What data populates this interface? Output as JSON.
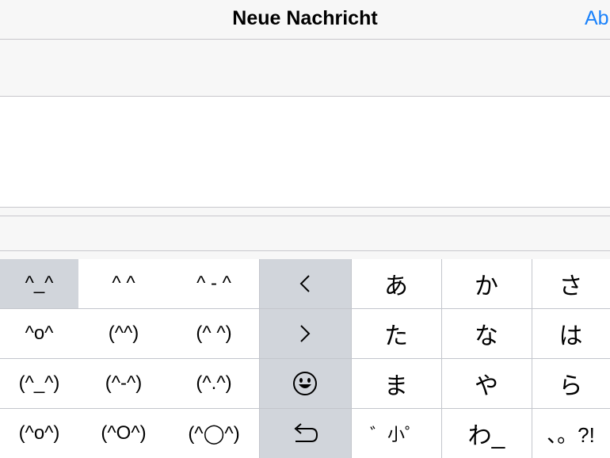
{
  "navbar": {
    "title": "Neue Nachricht",
    "cancel_label": "Ab"
  },
  "keyboard": {
    "faces": [
      [
        "^_^",
        "^ ^",
        "^ - ^"
      ],
      [
        "^o^",
        "(^^)",
        "(^ ^)"
      ],
      [
        "(^_^)",
        "(^-^)",
        "(^.^)"
      ],
      [
        "(^o^)",
        "(^O^)",
        "(^◯^)"
      ]
    ],
    "controls": [
      "‹",
      "›",
      "☺",
      "⮌"
    ],
    "control_icons": [
      "chevron-left-icon",
      "chevron-right-icon",
      "emoji-icon",
      "undo-icon"
    ],
    "kana": [
      [
        "あ",
        "か",
        "さ"
      ],
      [
        "た",
        "な",
        "は"
      ],
      [
        "ま",
        "や",
        "ら"
      ],
      [
        "゛小゜",
        "わ_",
        "、。?!"
      ]
    ]
  },
  "colors": {
    "accent": "#1a82fb",
    "key_highlight": "#d1d5db",
    "separator": "#c8c7cc"
  }
}
